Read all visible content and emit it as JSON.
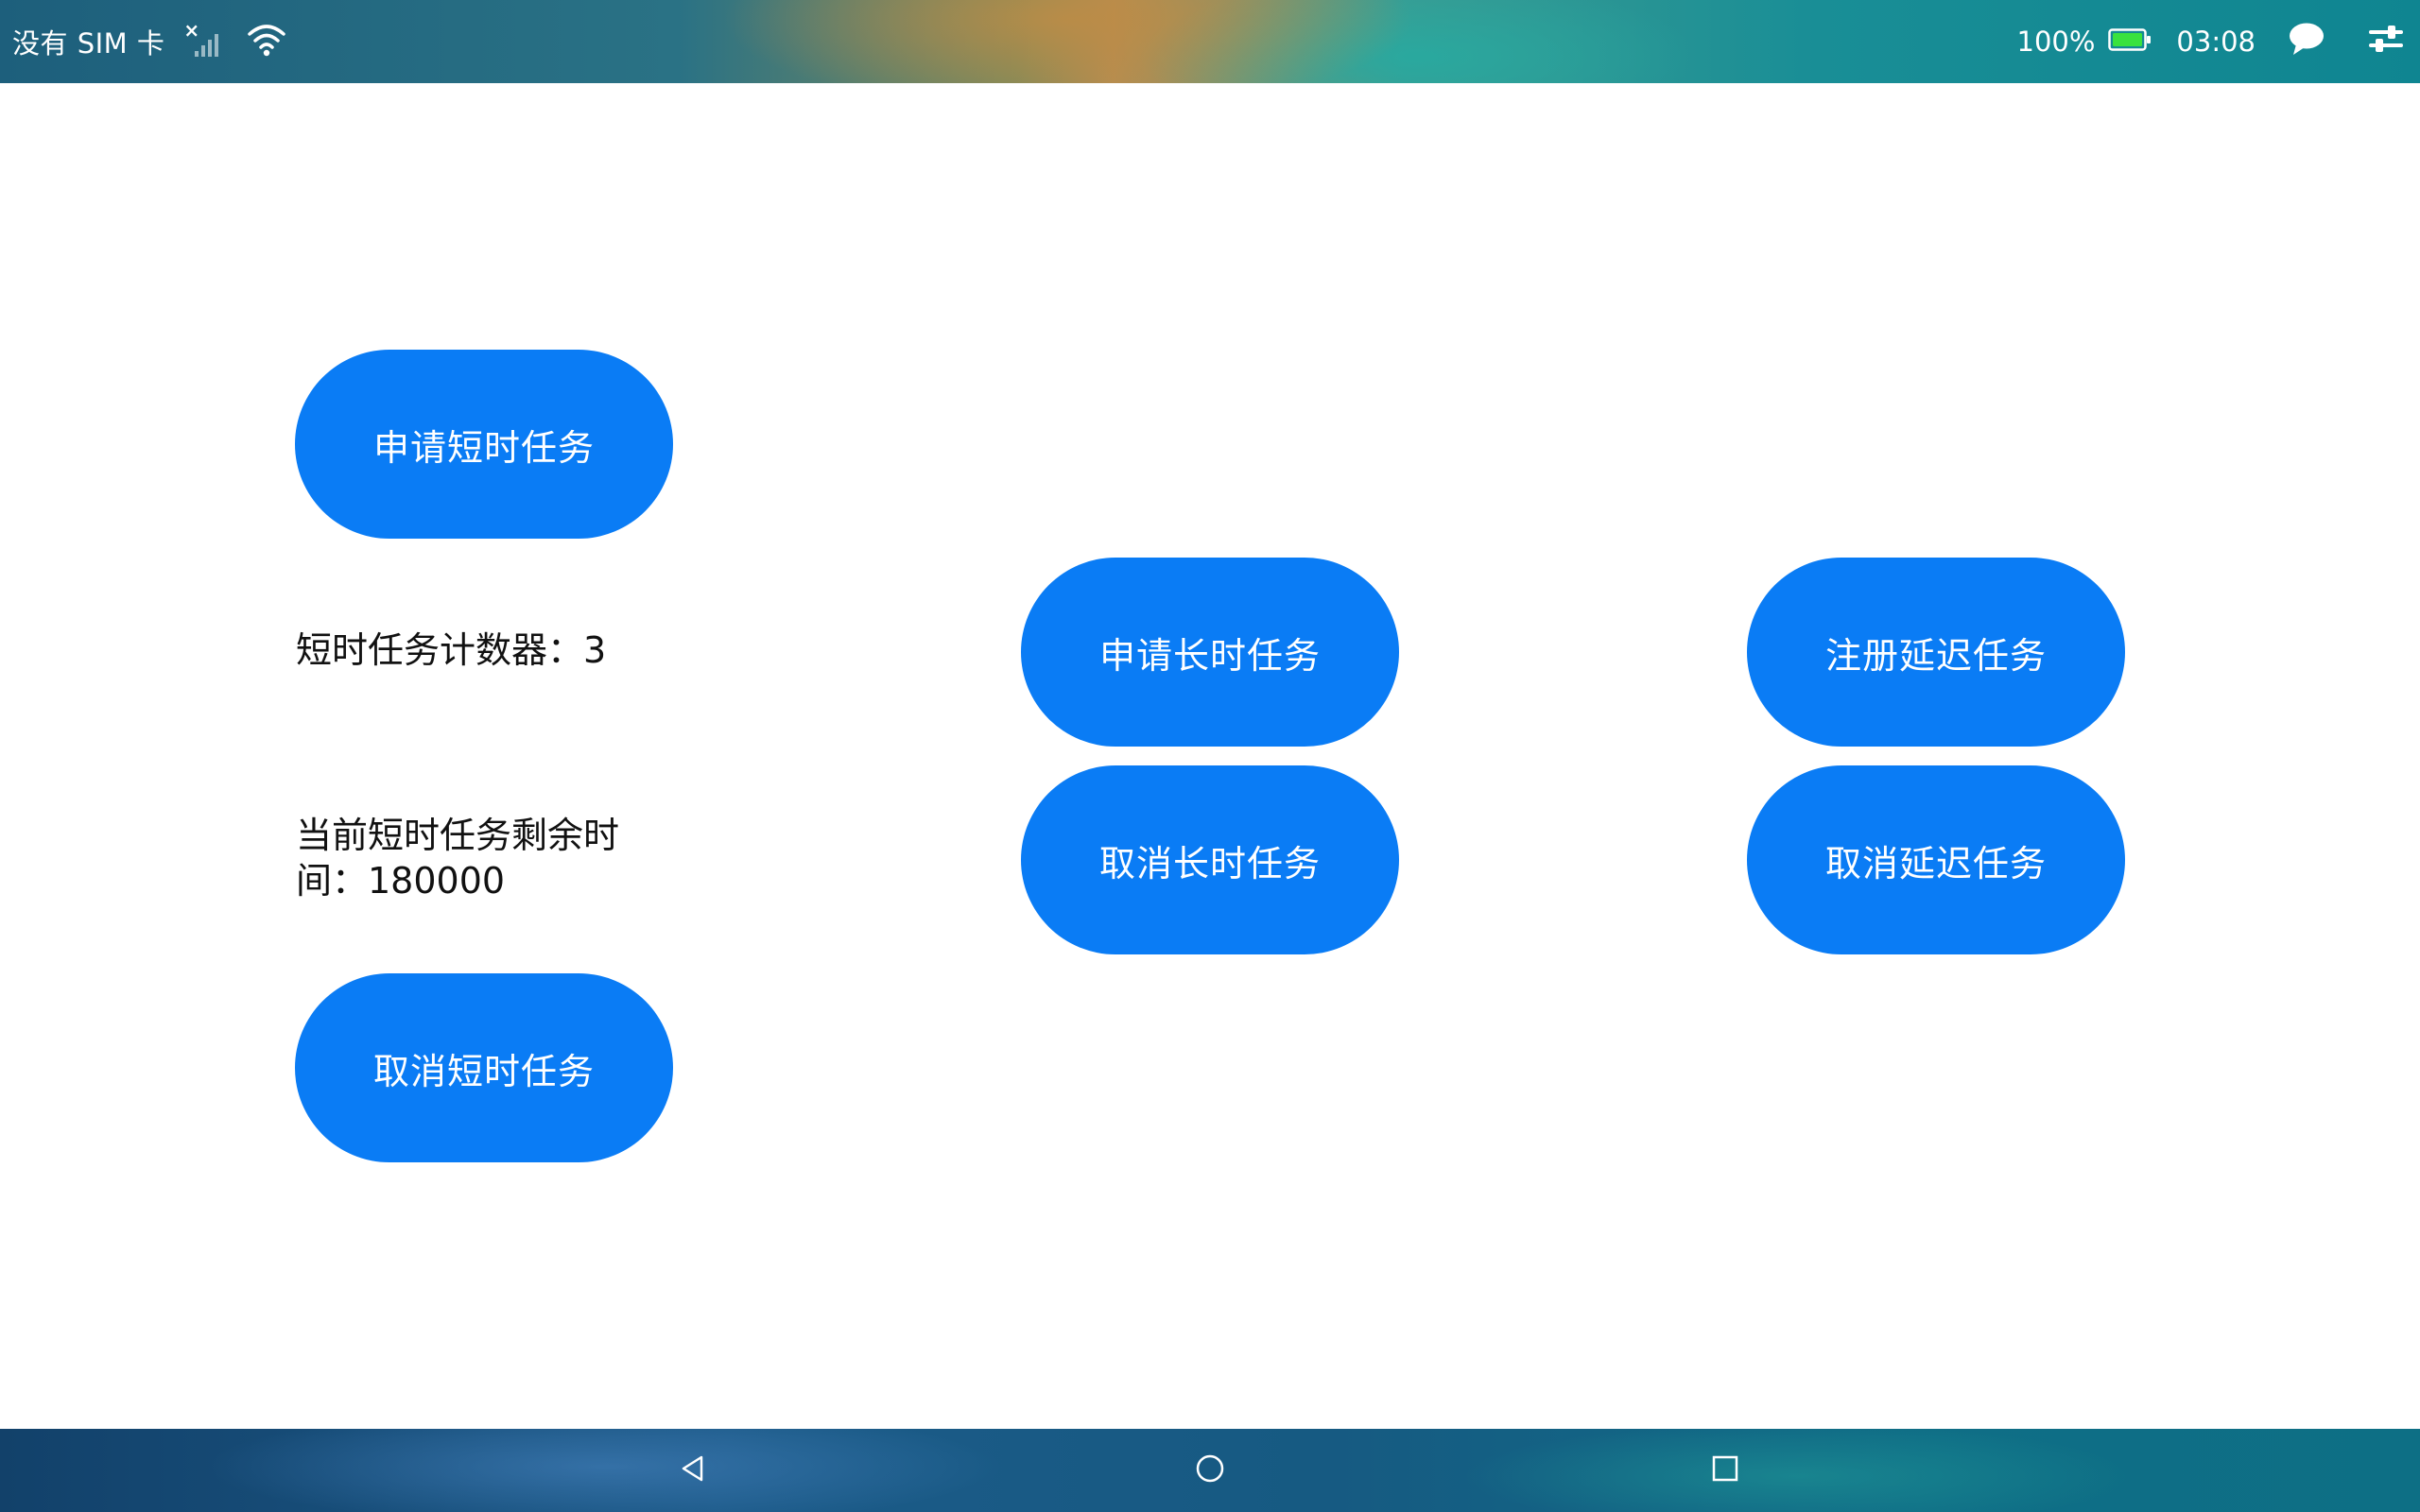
{
  "status_bar": {
    "sim_text": "没有 SIM 卡",
    "signal_mark": "×",
    "battery_percent": "100%",
    "time": "03:08",
    "icons": [
      "signal-icon",
      "wifi-icon",
      "battery-icon",
      "message-icon",
      "control-center-icon"
    ]
  },
  "short_task": {
    "apply_label": "申请短时任务",
    "counter_text": "短时任务计数器：3",
    "remaining_line1": "当前短时任务剩余时",
    "remaining_line2": "间：180000",
    "cancel_label": "取消短时任务"
  },
  "long_task": {
    "apply_label": "申请长时任务",
    "cancel_label": "取消长时任务"
  },
  "delay_task": {
    "register_label": "注册延迟任务",
    "cancel_label": "取消延迟任务"
  },
  "nav_bar": {
    "icons": [
      "back-icon",
      "home-icon",
      "recents-icon"
    ]
  },
  "colors": {
    "button_blue": "#0a7cf5",
    "text": "#111111",
    "battery_green": "#39e23e"
  }
}
